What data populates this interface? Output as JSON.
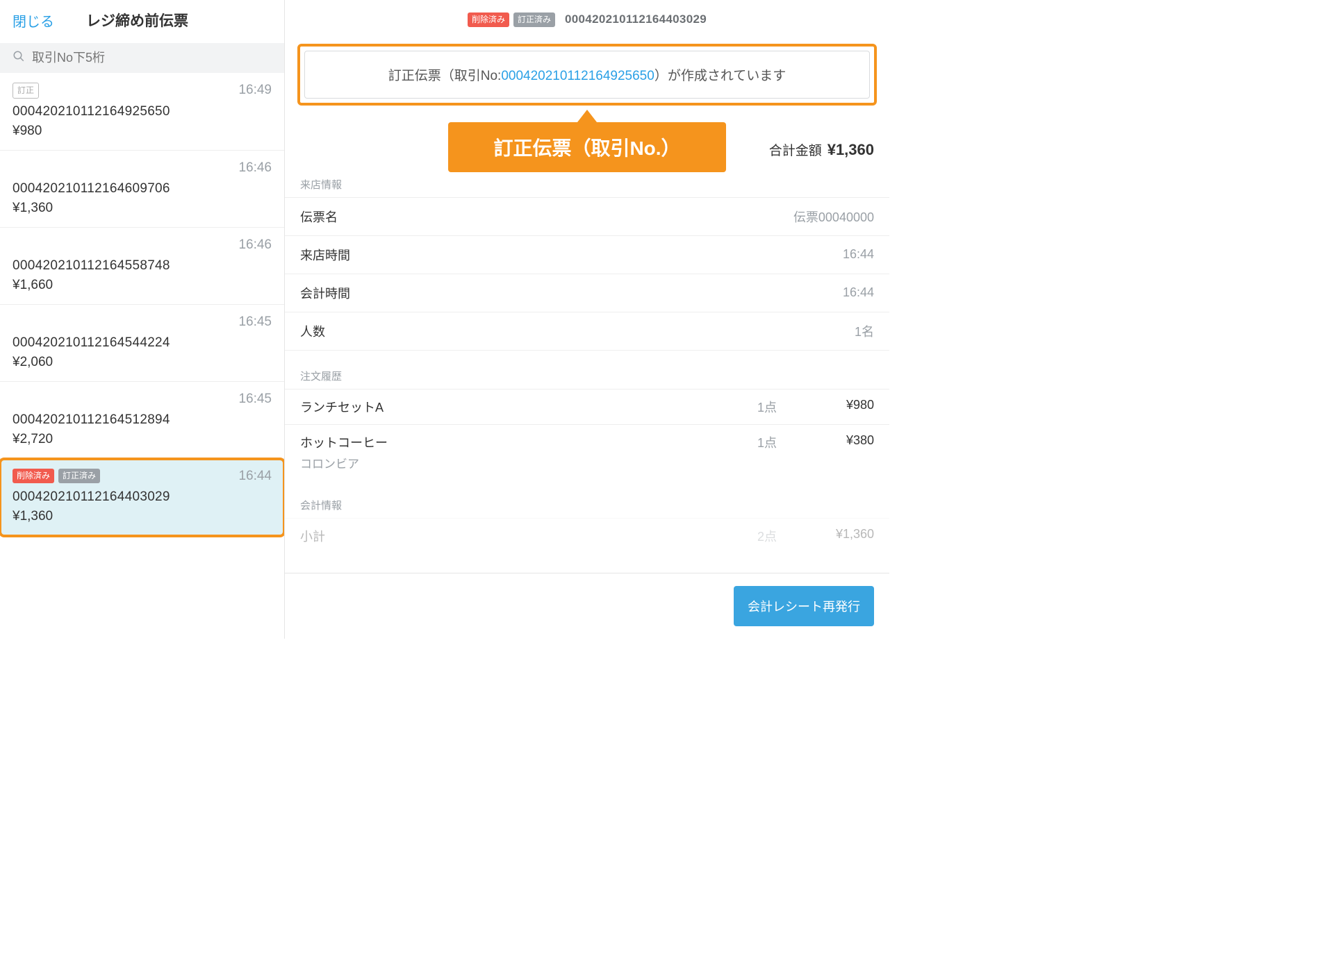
{
  "sidebar": {
    "close": "閉じる",
    "title": "レジ締め前伝票",
    "search_placeholder": "取引No下5桁",
    "items": [
      {
        "badges": [
          {
            "text": "訂正",
            "style": "outline"
          }
        ],
        "time": "16:49",
        "id": "00042021011216492565​0",
        "id_raw": "000420210112164925650",
        "price": "¥980"
      },
      {
        "badges": [],
        "time": "16:46",
        "id": "000420210112164609706",
        "price": "¥1,360"
      },
      {
        "badges": [],
        "time": "16:46",
        "id": "000420210112164558748",
        "price": "¥1,660"
      },
      {
        "badges": [],
        "time": "16:45",
        "id": "000420210112164544224",
        "price": "¥2,060"
      },
      {
        "badges": [],
        "time": "16:45",
        "id": "000420210112164512894",
        "price": "¥2,720"
      },
      {
        "badges": [
          {
            "text": "削除済み",
            "style": "red"
          },
          {
            "text": "訂正済み",
            "style": "gray"
          }
        ],
        "time": "16:44",
        "id": "000420210112164403029",
        "price": "¥1,360",
        "selected": true,
        "highlight": true
      }
    ]
  },
  "header": {
    "badges": [
      {
        "text": "削除済み",
        "style": "red"
      },
      {
        "text": "訂正済み",
        "style": "gray"
      }
    ],
    "id": "000420210112164403029"
  },
  "notice": {
    "before": "訂正伝票（取引No:",
    "link": "000420210112164925650",
    "after": "）が作成されています"
  },
  "callout": "訂正伝票（取引No.）",
  "total": {
    "label": "合計金額",
    "amount": "¥1,360"
  },
  "sections": {
    "visit_label": "来店情報",
    "visit": [
      {
        "k": "伝票名",
        "v": "伝票00040000"
      },
      {
        "k": "来店時間",
        "v": "16:44"
      },
      {
        "k": "会計時間",
        "v": "16:44"
      },
      {
        "k": "人数",
        "v": "1名"
      }
    ],
    "order_label": "注文履歴",
    "orders": [
      {
        "name": "ランチセットA",
        "qty": "1点",
        "price": "¥980"
      },
      {
        "name": "ホットコーヒー",
        "qty": "1点",
        "price": "¥380",
        "sub": "コロンビア"
      }
    ],
    "summary_label": "会計情報",
    "summary": [
      {
        "lbl": "小計",
        "qty": "2点",
        "amt": "¥1,360"
      }
    ]
  },
  "footer": {
    "reissue": "会計レシート再発行"
  }
}
